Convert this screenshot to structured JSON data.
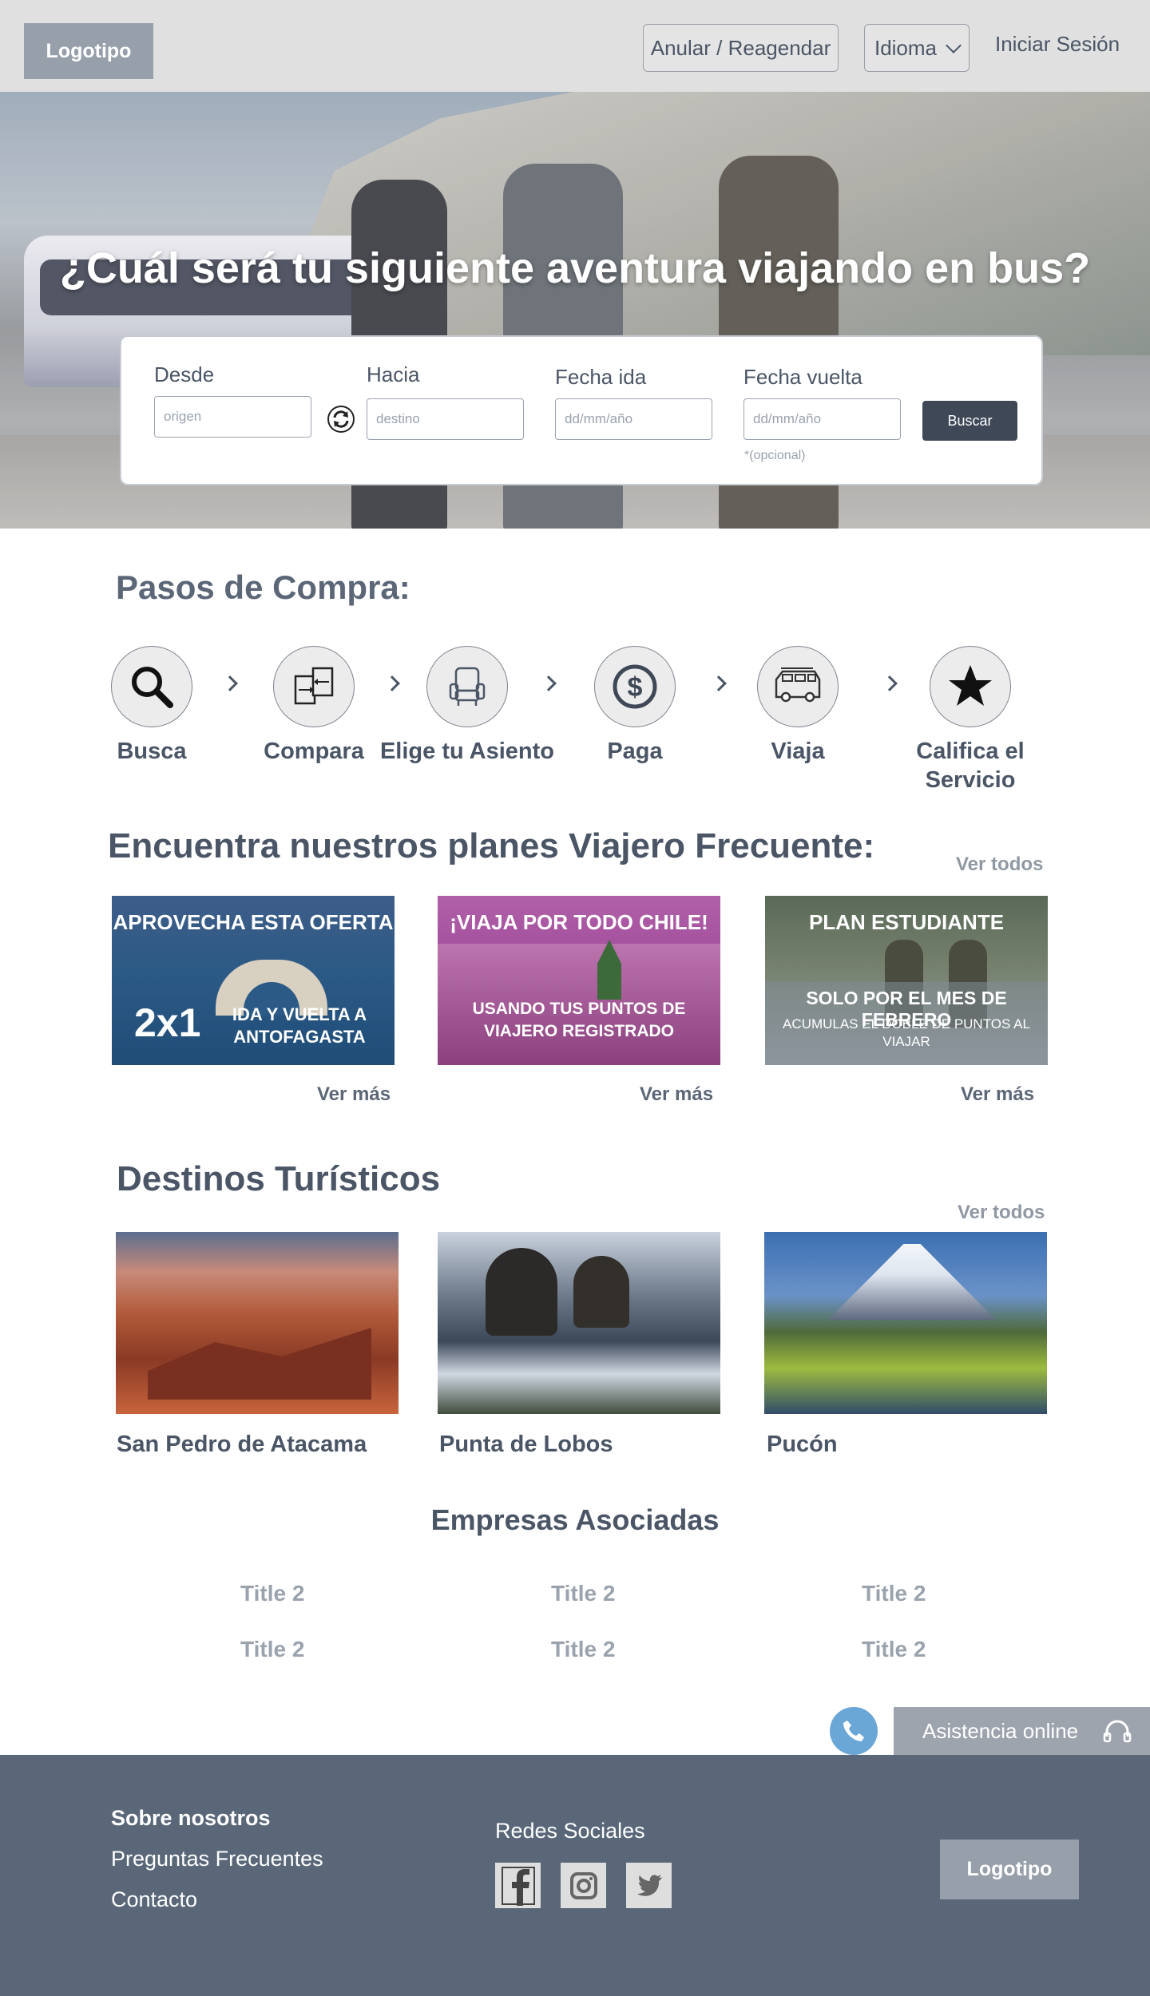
{
  "header": {
    "logo": "Logotipo",
    "anular": "Anular / Reagendar",
    "idioma": "Idioma",
    "login": "Iniciar Sesión"
  },
  "hero": {
    "title": "¿Cuál será tu siguiente aventura viajando en bus?"
  },
  "search": {
    "desde_label": "Desde",
    "desde_placeholder": "origen",
    "hacia_label": "Hacia",
    "hacia_placeholder": "destino",
    "ida_label": "Fecha ida",
    "ida_placeholder": "dd/mm/año",
    "vuelta_label": "Fecha vuelta",
    "vuelta_placeholder": "dd/mm/año",
    "vuelta_note": "*(opcional)",
    "button": "Buscar"
  },
  "steps": {
    "title": "Pasos de Compra:",
    "items": [
      {
        "label": "Busca",
        "icon": "search-icon"
      },
      {
        "label": "Compara",
        "icon": "compare-icon"
      },
      {
        "label": "Elige tu Asiento",
        "icon": "seat-icon"
      },
      {
        "label": "Paga",
        "icon": "dollar-icon"
      },
      {
        "label": "Viaja",
        "icon": "bus-icon"
      },
      {
        "label": "Califica el Servicio",
        "icon": "star-icon"
      }
    ]
  },
  "planes": {
    "title": "Encuentra nuestros planes Viajero Frecuente:",
    "ver_todos": "Ver todos",
    "cards": [
      {
        "head": "APROVECHA ESTA OFERTA",
        "big": "2x1",
        "text": "IDA Y VUELTA A ANTOFAGASTA",
        "ver_mas": "Ver más"
      },
      {
        "head": "¡VIAJA POR TODO CHILE!",
        "text": "USANDO TUS PUNTOS DE VIAJERO REGISTRADO",
        "ver_mas": "Ver más"
      },
      {
        "head": "PLAN ESTUDIANTE",
        "sub": "SOLO POR EL MES DE FEBRERO",
        "text": "ACUMULAS EL DOBLE DE PUNTOS AL VIAJAR",
        "ver_mas": "Ver más"
      }
    ]
  },
  "destinos": {
    "title": "Destinos Turísticos",
    "ver_todos": "Ver todos",
    "items": [
      {
        "name": "San Pedro de Atacama"
      },
      {
        "name": "Punta de Lobos"
      },
      {
        "name": "Pucón"
      }
    ]
  },
  "empresas": {
    "title": "Empresas Asociadas",
    "items": [
      "Title 2",
      "Title 2",
      "Title 2",
      "Title 2",
      "Title 2",
      "Title 2"
    ]
  },
  "asistencia": {
    "label": "Asistencia online"
  },
  "footer": {
    "sobre": "Sobre nosotros",
    "preguntas": "Preguntas Frecuentes",
    "contacto": "Contacto",
    "redes": "Redes Sociales",
    "logo": "Logotipo"
  },
  "colors": {
    "header_bg": "#e0e0e0",
    "text": "#4a5566",
    "footer_bg": "#596778",
    "button_dark": "#3f4857",
    "phone_blue": "#6aa6d6"
  }
}
